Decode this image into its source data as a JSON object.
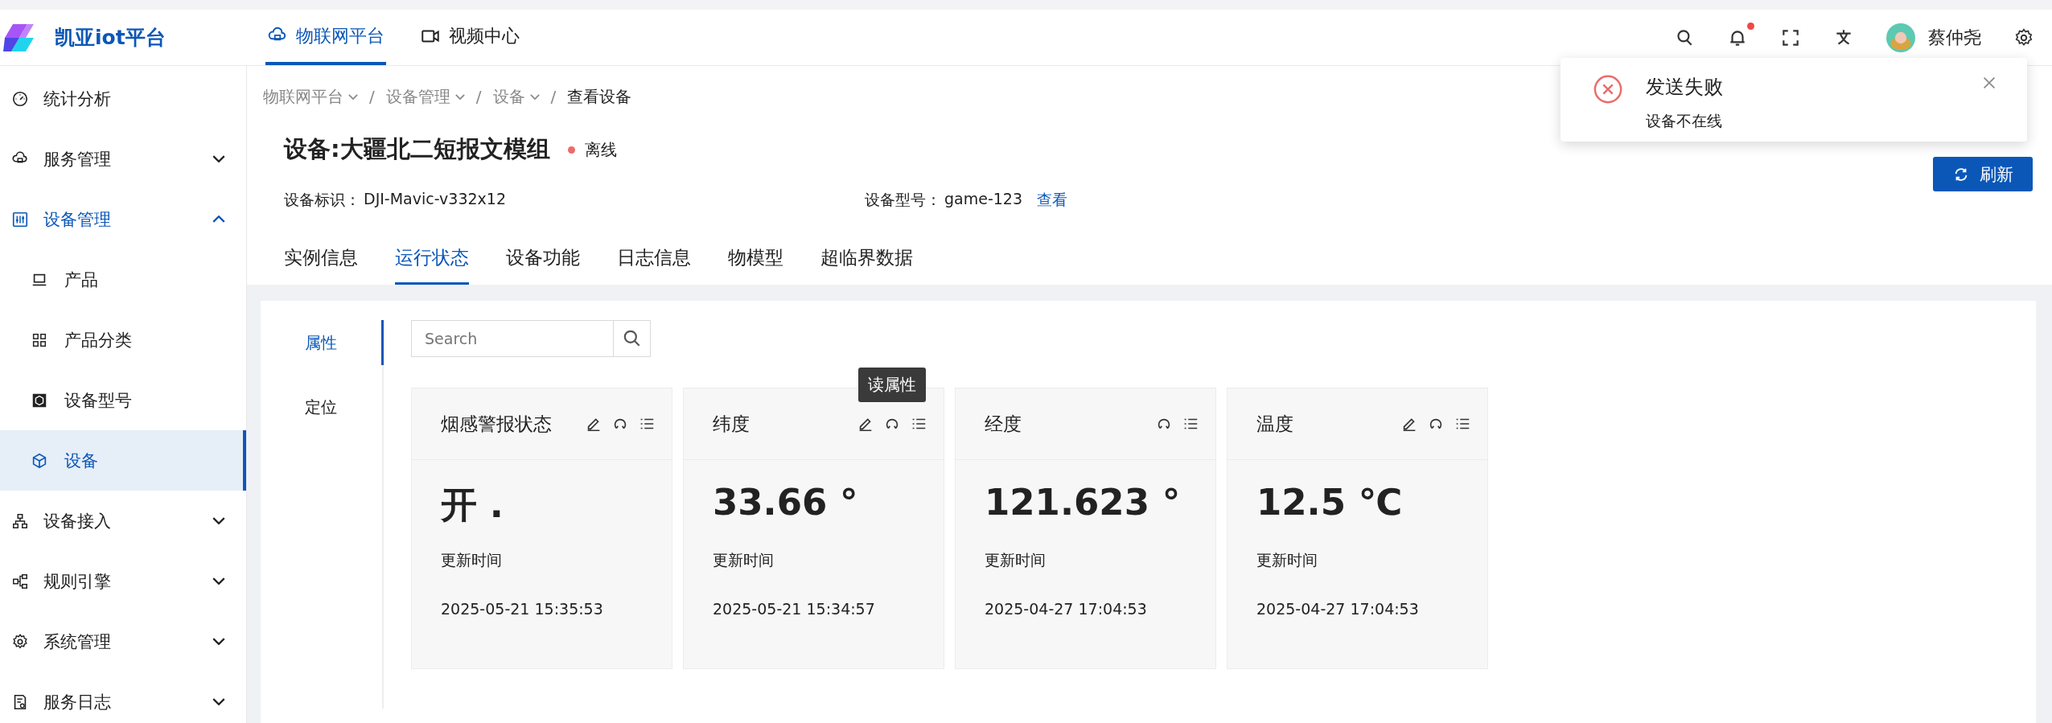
{
  "app": {
    "logo_text": "凯亚iot平台"
  },
  "top_nav": [
    {
      "label": "物联网平台",
      "selected": true
    },
    {
      "label": "视频中心",
      "selected": false
    }
  ],
  "header": {
    "user_name": "蔡仲尧",
    "notification_dot": true
  },
  "sidebar": {
    "items": [
      {
        "label": "统计分析",
        "selected": false
      },
      {
        "label": "服务管理",
        "selected": false,
        "expanded": false
      },
      {
        "label": "设备管理",
        "selected": true,
        "expanded": true,
        "children": [
          {
            "label": "产品",
            "selected": false
          },
          {
            "label": "产品分类",
            "selected": false
          },
          {
            "label": "设备型号",
            "selected": false
          },
          {
            "label": "设备",
            "selected": true
          }
        ]
      },
      {
        "label": "设备接入",
        "selected": false,
        "expanded": false
      },
      {
        "label": "规则引擎",
        "selected": false,
        "expanded": false
      },
      {
        "label": "系统管理",
        "selected": false,
        "expanded": false
      },
      {
        "label": "服务日志",
        "selected": false,
        "expanded": false
      }
    ]
  },
  "breadcrumb": [
    {
      "label": "物联网平台",
      "dropdown": true
    },
    {
      "separator": "/",
      "label": "设备管理",
      "dropdown": true
    },
    {
      "separator": "/",
      "label": "设备",
      "dropdown": true
    },
    {
      "separator": "/",
      "label": "查看设备",
      "dropdown": false
    }
  ],
  "device": {
    "title": "设备:大疆北二短报文模组",
    "online": false,
    "status": "离线",
    "fields": [
      {
        "label": "设备标识：",
        "value": "DJI-Mavic-v332x12"
      },
      {
        "label": "设备型号：",
        "value": "game-123",
        "link": "查看"
      }
    ]
  },
  "refresh_button": "刷新",
  "tabs": [
    {
      "label": "实例信息",
      "selected": false
    },
    {
      "label": "运行状态",
      "selected": true
    },
    {
      "label": "设备功能",
      "selected": false
    },
    {
      "label": "日志信息",
      "selected": false
    },
    {
      "label": "物模型",
      "selected": false
    },
    {
      "label": "超临界数据",
      "selected": false
    }
  ],
  "side_tabs": [
    {
      "label": "属性",
      "selected": true
    },
    {
      "label": "定位",
      "selected": false
    }
  ],
  "search": {
    "placeholder": "Search"
  },
  "properties": [
    {
      "name": "烟感警报状态",
      "writable": true,
      "value": "开 .",
      "updated_label": "更新时间",
      "updated_at": "2025-05-21 15:35:53"
    },
    {
      "name": "纬度",
      "writable": true,
      "tooltip": "读属性",
      "value": "33.66 °",
      "updated_label": "更新时间",
      "updated_at": "2025-05-21 15:34:57"
    },
    {
      "name": "经度",
      "writable": false,
      "value": "121.623 °",
      "updated_label": "更新时间",
      "updated_at": "2025-04-27 17:04:53"
    },
    {
      "name": "温度",
      "writable": true,
      "value": "12.5 ℃",
      "updated_label": "更新时间",
      "updated_at": "2025-04-27 17:04:53"
    }
  ],
  "notification": {
    "kind": "error",
    "title": "发送失败",
    "message": "设备不在线"
  }
}
